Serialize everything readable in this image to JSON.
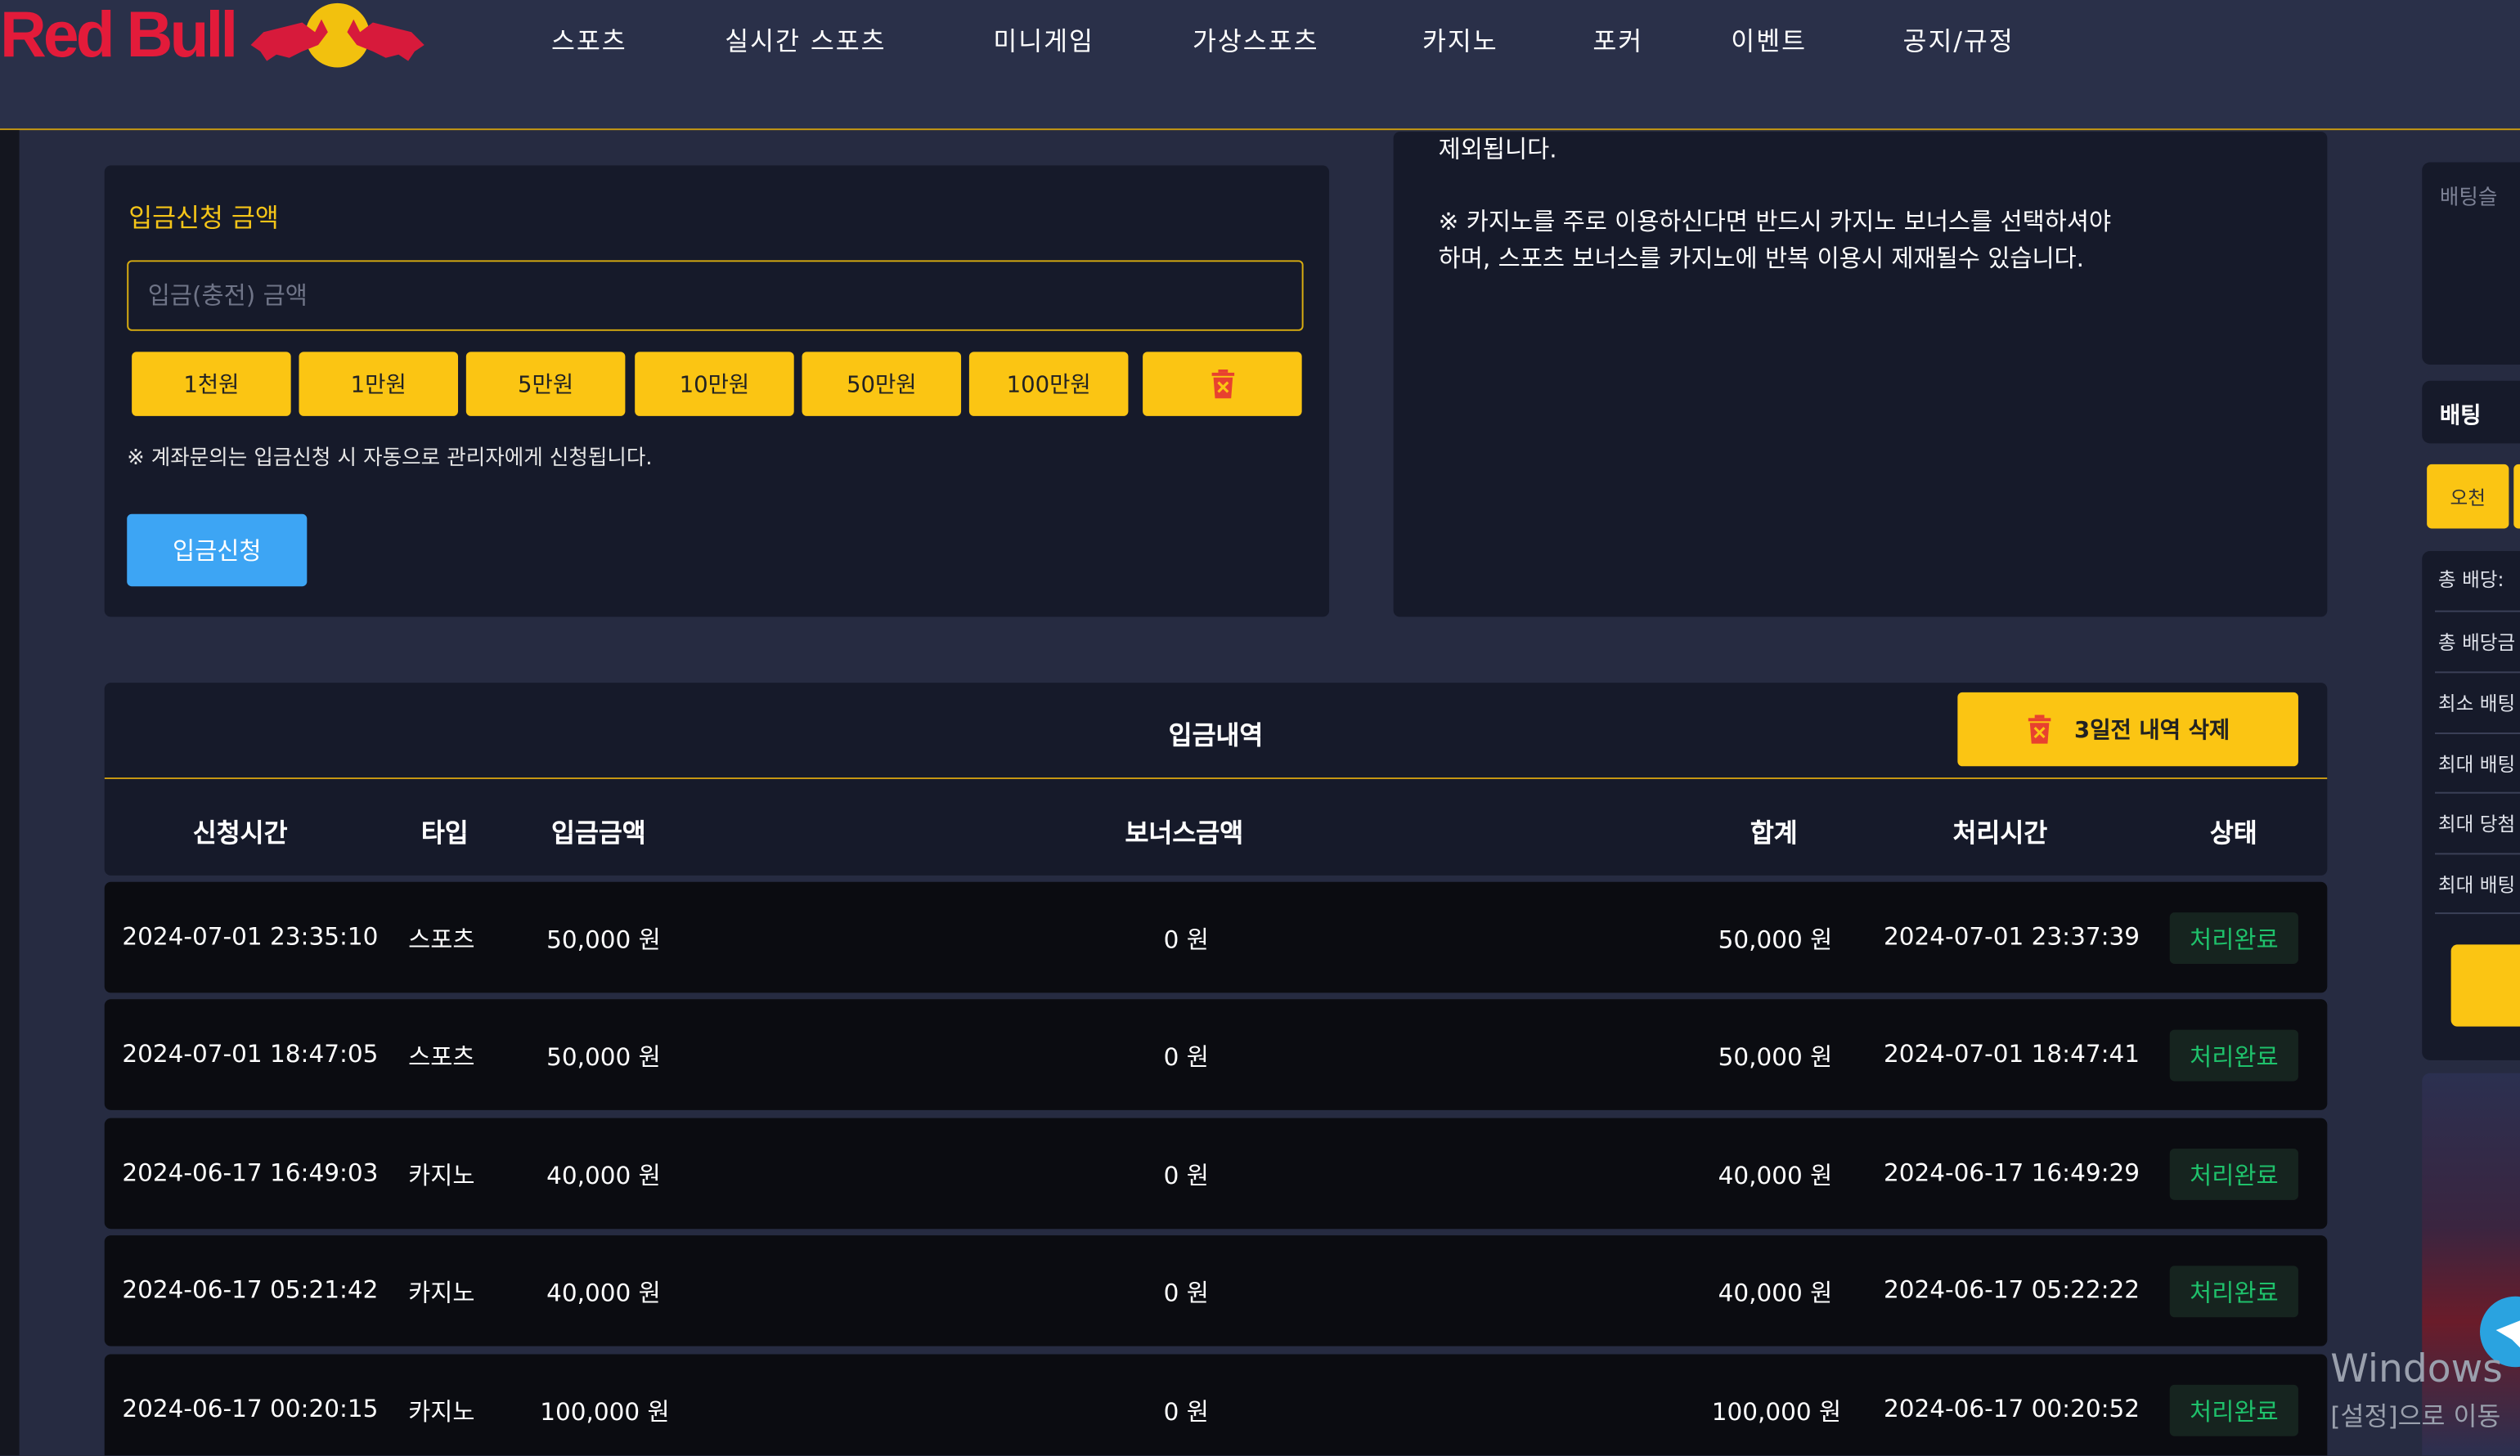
{
  "brand": {
    "logo_text": "Red Bull"
  },
  "nav": [
    "스포츠",
    "실시간 스포츠",
    "미니게임",
    "가상스포츠",
    "카지노",
    "포커",
    "이벤트",
    "공지/규정"
  ],
  "deposit": {
    "title": "입금신청 금액",
    "input_placeholder": "입금(충전) 금액",
    "amount_buttons": [
      "1천원",
      "1만원",
      "5만원",
      "10만원",
      "50만원",
      "100만원"
    ],
    "notice": "※ 계좌문의는 입금신청 시 자동으로 관리자에게 신청됩니다.",
    "submit_label": "입금신청"
  },
  "info": {
    "line1": "제외됩니다.",
    "line2": "※ 카지노를 주로 이용하신다면 반드시 카지노 보너스를 선택하셔야",
    "line3": "하며, 스포츠 보너스를 카지노에 반복 이용시 제재될수 있습니다."
  },
  "history": {
    "title": "입금내역",
    "delete_label": "3일전 내역 삭제",
    "columns": [
      "신청시간",
      "타입",
      "입금금액",
      "보너스금액",
      "합계",
      "처리시간",
      "상태"
    ],
    "rows": [
      {
        "time": "2024-07-01 23:35:10",
        "type": "스포츠",
        "amount": "50,000 원",
        "bonus": "0 원",
        "total": "50,000 원",
        "processed": "2024-07-01 23:37:39",
        "status": "처리완료"
      },
      {
        "time": "2024-07-01 18:47:05",
        "type": "스포츠",
        "amount": "50,000 원",
        "bonus": "0 원",
        "total": "50,000 원",
        "processed": "2024-07-01 18:47:41",
        "status": "처리완료"
      },
      {
        "time": "2024-06-17 16:49:03",
        "type": "카지노",
        "amount": "40,000 원",
        "bonus": "0 원",
        "total": "40,000 원",
        "processed": "2024-06-17 16:49:29",
        "status": "처리완료"
      },
      {
        "time": "2024-06-17 05:21:42",
        "type": "카지노",
        "amount": "40,000 원",
        "bonus": "0 원",
        "total": "40,000 원",
        "processed": "2024-06-17 05:22:22",
        "status": "처리완료"
      },
      {
        "time": "2024-06-17 00:20:15",
        "type": "카지노",
        "amount": "100,000 원",
        "bonus": "0 원",
        "total": "100,000 원",
        "processed": "2024-06-17 00:20:52",
        "status": "처리완료"
      }
    ]
  },
  "sidebar": {
    "slip_label": "배팅슬",
    "bet_label": "배팅",
    "quick_label": "오천",
    "rows": [
      "총 배당:",
      "총 배당금",
      "최소 배팅",
      "최대 배팅",
      "최대 당첨",
      "최대 배팅"
    ]
  },
  "watermark": {
    "line1": "Windows",
    "line2": "[설정]으로 이동"
  },
  "colors": {
    "accent": "#fbc513",
    "primary_button": "#3da5f4",
    "status_green": "#1fc16b",
    "brand_red": "#e31b3a"
  }
}
